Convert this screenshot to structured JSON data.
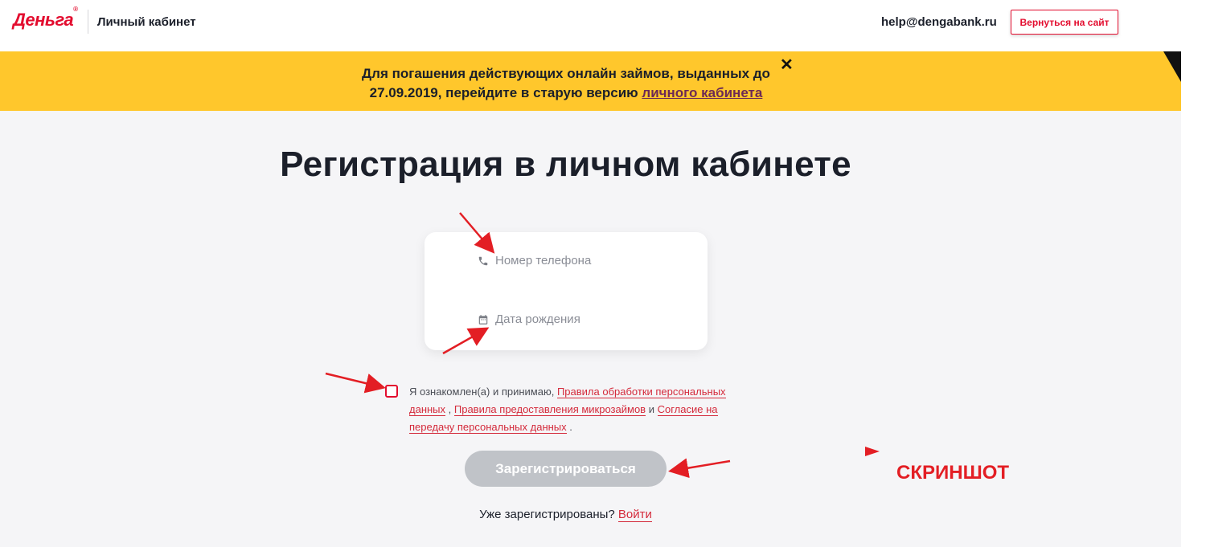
{
  "header": {
    "logo": "Деньга",
    "logo_mark": "®",
    "cabinet_title": "Личный кабинет",
    "help_email": "help@dengabank.ru",
    "back_button": "Вернуться на сайт"
  },
  "banner": {
    "text_line1": "Для погашения действующих онлайн займов, выданных до",
    "text_line2_prefix": "27.09.2019, перейдите в старую версию ",
    "link": "личного кабинета",
    "close": "✕"
  },
  "main": {
    "title": "Регистрация в личном кабинете",
    "phone_placeholder": "Номер телефона",
    "dob_placeholder": "Дата рождения",
    "consent": {
      "prefix": "Я ознакомлен(а) и принимаю, ",
      "link1": "Правила обработки персональных данных",
      "sep1": " , ",
      "link2": "Правила предоставления микрозаймов",
      "sep2": " и ",
      "link3": "Согласие на передачу персональных данных",
      "suffix": " ."
    },
    "register_button": "Зарегистрироваться",
    "login_prefix": "Уже зарегистрированы? ",
    "login_link": "Войти"
  },
  "annotation": {
    "label": "СКРИНШОТ"
  },
  "icons": {
    "phone": "phone-icon",
    "calendar": "calendar-icon",
    "close": "close-icon"
  },
  "colors": {
    "brand_red": "#e30d2f",
    "banner_yellow": "#ffc72c",
    "button_disabled": "#c0c3c8",
    "annotation_red": "#e31e24"
  }
}
